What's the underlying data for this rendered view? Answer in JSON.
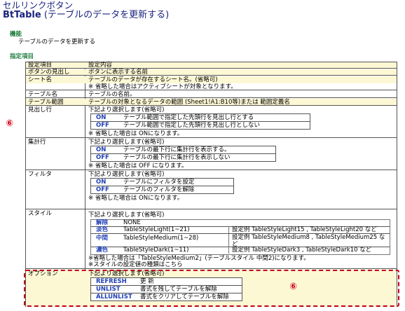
{
  "header": {
    "title": "セルリンクボタン",
    "subtitle_bold": "BtTable",
    "subtitle_rest": "(テーブルのデータを更新する)"
  },
  "function_section": {
    "heading": "機能",
    "description": "テーブルのデータを更新する"
  },
  "spec_section": {
    "heading": "指定項目",
    "col_item": "設定項目",
    "col_content": "設定内容"
  },
  "rows": {
    "button_label": {
      "name": "ボタンの見出し",
      "desc": "ボタンに表示する名前"
    },
    "sheet_name": {
      "name": "シート名",
      "desc": "テーブルのデータが存在するシート名。(省略可)",
      "note": "※ 省略した場合はアクティブシートが対象となります。"
    },
    "table_name": {
      "name": "テーブル名",
      "desc": "テーブルの名前。"
    },
    "table_range": {
      "name": "テーブル範囲",
      "desc": "テーブルの対象となるデータの範囲 (Sheet1!A1:B10等)または 範囲定義名"
    },
    "header_row": {
      "name": "見出し行",
      "intro": "下記より選択します(省略可)",
      "options": [
        {
          "key": "ON",
          "desc": "テーブル範囲で指定した先頭行を見出し行とする"
        },
        {
          "key": "OFF",
          "desc": "テーブル範囲で指定した先頭行を見出し行としない"
        }
      ],
      "note": "※ 省略した場合は ONになります。"
    },
    "total_row": {
      "name": "集計行",
      "intro": "下記より選択します(省略可)",
      "options": [
        {
          "key": "ON",
          "desc": "テーブルの最下行に集計行を表示する。"
        },
        {
          "key": "OFF",
          "desc": "テーブルの最下行に集計行を表示しない"
        }
      ],
      "note": "※ 省略した場合は OFF になります。"
    },
    "filter": {
      "name": "フィルタ",
      "intro": "下記より選択します(省略可)",
      "options": [
        {
          "key": "ON",
          "desc": "テーブルにフィルタを設定"
        },
        {
          "key": "OFF",
          "desc": "テーブルのフィルタを解除"
        }
      ],
      "note": "※ 省略した場合は ONになります。"
    },
    "style": {
      "name": "スタイル",
      "intro": "下記より選択します(省略可)",
      "options": [
        {
          "key": "解除",
          "desc": "NONE",
          "example": ""
        },
        {
          "key": "淡色",
          "desc": "TableStyleLight(1~21)",
          "example": "設定例 TableStyleLight15 , TableStyleLight20 など"
        },
        {
          "key": "中間",
          "desc": "TableStyleMedium(1~28)",
          "example": "設定例 TableStyleMedium8 , TableStyleMedium25 な",
          "example2": "ど"
        },
        {
          "key": "濃色",
          "desc": "TableStyleDark(1~11)",
          "example": "設定例 TableStyleDark3 , TableStyleDark10 など"
        }
      ],
      "note1": "※省略した場合は「TableStyleMedium2」(テーブルスタイル 中間2)になります。",
      "note2": "※スタイルの設定値の種類はこちら"
    },
    "option": {
      "name": "オプション",
      "intro": "下記より選択します(省略可)",
      "options": [
        {
          "key": "REFRESH",
          "desc": "更 新"
        },
        {
          "key": "UNLIST",
          "desc": "書式を残してテーブルを解除"
        },
        {
          "key": "ALLUNLIST",
          "desc": "書式をクリアしてテーブルを解除"
        }
      ]
    }
  },
  "markers": {
    "left": "⑥",
    "right": "⑥"
  },
  "colors": {
    "title": "#1a237e",
    "section_heading": "#1b7a3c",
    "keyword": "#1f3fb5",
    "stripe": "#fdf8d4",
    "marker": "#d0021b"
  }
}
